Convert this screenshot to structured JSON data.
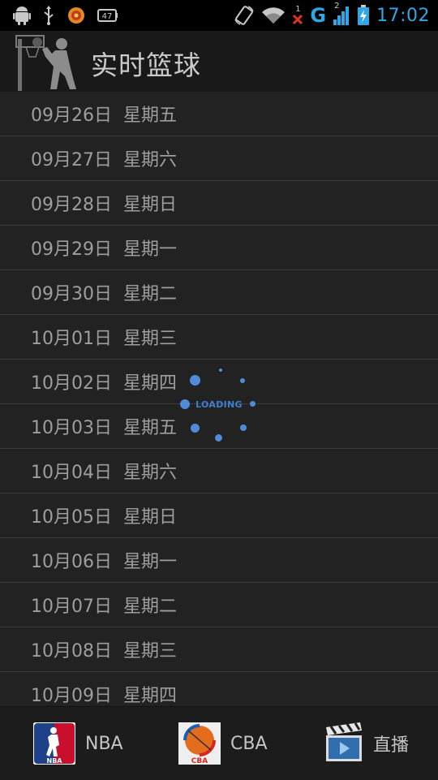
{
  "status_bar": {
    "battery_level": "47",
    "network_type": "G",
    "signal_badge": "2",
    "notification_badge": "1",
    "time": "17:02"
  },
  "header": {
    "title": "实时篮球"
  },
  "dates": [
    "09月26日  星期五",
    "09月27日  星期六",
    "09月28日  星期日",
    "09月29日  星期一",
    "09月30日  星期二",
    "10月01日  星期三",
    "10月02日  星期四",
    "10月03日  星期五",
    "10月04日  星期六",
    "10月05日  星期日",
    "10月06日  星期一",
    "10月07日  星期二",
    "10月08日  星期三",
    "10月09日  星期四"
  ],
  "loading": {
    "text": "LOADING"
  },
  "tabs": {
    "nba": "NBA",
    "cba": "CBA",
    "live": "直播"
  },
  "colors": {
    "accent": "#2fa7e6",
    "loading_blue": "#4f8bd6",
    "background": "#222222",
    "row_divider": "#3c3c3c"
  }
}
